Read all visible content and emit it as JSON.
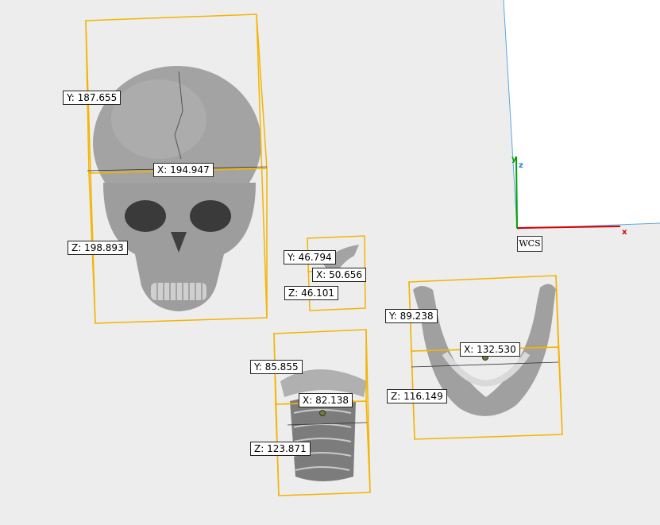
{
  "objects": [
    {
      "name": "skull",
      "dims": {
        "y": "Y: 187.655",
        "x": "X: 194.947",
        "z": "Z: 198.893"
      }
    },
    {
      "name": "small-fragment",
      "dims": {
        "y": "Y: 46.794",
        "x": "X: 50.656",
        "z": "Z: 46.101"
      }
    },
    {
      "name": "vertebrae",
      "dims": {
        "y": "Y: 85.855",
        "x": "X: 82.138",
        "z": "Z: 123.871"
      }
    },
    {
      "name": "mandible",
      "dims": {
        "y": "Y: 89.238",
        "x": "X: 132.530",
        "z": "Z: 116.149"
      }
    }
  ],
  "axes": {
    "x_label": "x",
    "y_label": "y",
    "z_label": "z",
    "wcs_label": "WCS"
  },
  "colors": {
    "background": "#ededed",
    "bounding_box": "#f4b400",
    "bone": "#9a9a9a",
    "x_axis": "#d40000",
    "y_axis": "#00a000",
    "z_axis": "#2a7de1",
    "guide": "#5aa7e6"
  }
}
